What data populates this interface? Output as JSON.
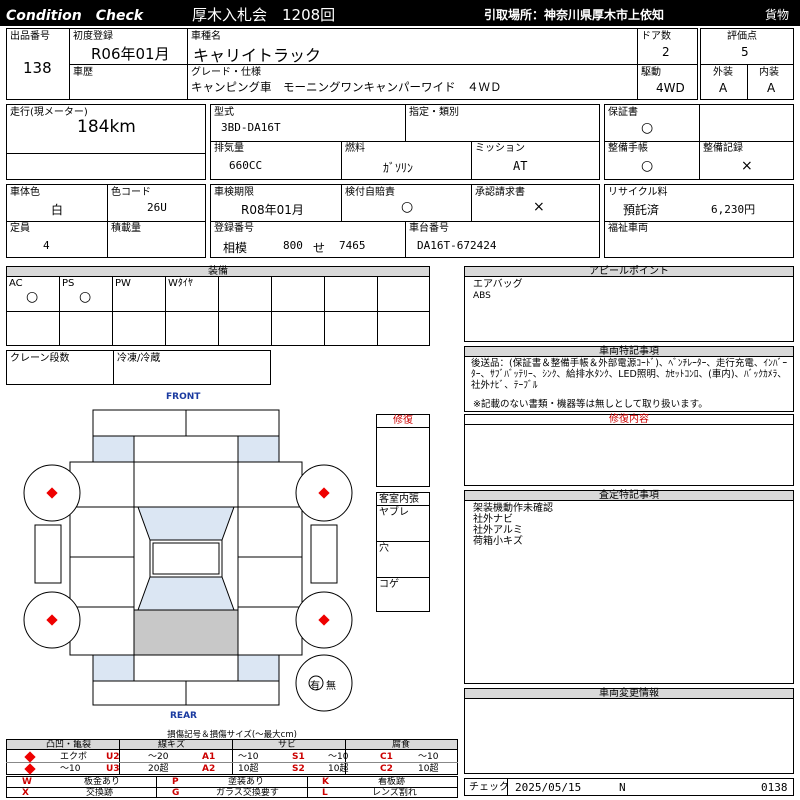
{
  "header": {
    "title": "Condition　Check",
    "auction": "厚木入札会　1208回",
    "pickup": "引取場所：神奈川県厚木市上依知",
    "category": "貨物"
  },
  "vehicle": {
    "lot_label": "出品番号",
    "lot": "138",
    "first_reg_label": "初度登録",
    "first_reg": "R06年01月",
    "name_label": "車種名",
    "name": "キャリイトラック",
    "doors_label": "ドア数",
    "doors": "2",
    "score_label": "評価点",
    "score": "5",
    "history_label": "車歴",
    "grade_label": "グレード・仕様",
    "grade": "キャンピング車　モーニングワンキャンパーワイド　４ＷＤ",
    "drive_label": "駆動",
    "drive": "4WD",
    "exterior_label": "外装",
    "exterior": "A",
    "interior_label": "内装",
    "interior": "A"
  },
  "specs": {
    "mileage_label": "走行(現メーター)",
    "mileage": "184km",
    "model_label": "型式",
    "model": "3BD-DA16T",
    "designation_label": "指定・類別",
    "warranty_label": "保証書",
    "warranty": "○",
    "displacement_label": "排気量",
    "displacement": "660CC",
    "fuel_label": "燃料",
    "fuel": "ｶﾞｿﾘﾝ",
    "transmission_label": "ミッション",
    "transmission": "AT",
    "manual_label": "整備手帳",
    "manual": "○",
    "service_label": "整備記録",
    "service": "×",
    "body_color_label": "車体色",
    "body_color": "白",
    "color_code_label": "色コード",
    "color_code": "26U",
    "inspection_label": "車検期限",
    "inspection": "R08年01月",
    "insurance_label": "検付自賠責",
    "insurance": "○",
    "transfer_label": "承認請求書",
    "transfer": "×",
    "recycle_label": "リサイクル料",
    "recycle_status": "預託済",
    "recycle_amount": "6,230円",
    "capacity_label": "定員",
    "capacity": "4",
    "load_label": "積載量",
    "reg_label": "登録番号",
    "reg_area": "相模",
    "reg_class": "800",
    "reg_kana": "せ",
    "reg_number": "7465",
    "chassis_label": "車台番号",
    "chassis": "DA16T-672424",
    "welfare_label": "福祉車両"
  },
  "equipment": {
    "title": "装備",
    "items": [
      {
        "label": "AC",
        "value": "○"
      },
      {
        "label": "PS",
        "value": "○"
      },
      {
        "label": "PW",
        "value": ""
      },
      {
        "label": "Wﾀｲﾔ",
        "value": ""
      }
    ],
    "crane_label": "クレーン段数",
    "fridge_label": "冷凍/冷蔵"
  },
  "appeal": {
    "title": "アピールポイント",
    "line1": "エアバッグ",
    "line2": "ABS"
  },
  "remarks": {
    "title": "車両特記事項",
    "text": "後送品：(保証書＆整備手帳＆外部電源ｺｰﾄﾞ)、ﾍﾞﾝﾁﾚｰﾀｰ、走行充電、ｲﾝﾊﾞｰﾀｰ、ｻﾌﾞﾊﾞｯﾃﾘｰ、ｼﾝｸ、給排水ﾀﾝｸ、LED照明、ｶｾｯﾄｺﾝﾛ、(車内)、ﾊﾞｯｸｶﾒﾗ、社外ﾅﾋﾞ、ﾃｰﾌﾞﾙ",
    "note": "※記載のない書類・機器等は無しとして取り扱います。"
  },
  "repair": {
    "label": "修復",
    "content_title": "修復内容"
  },
  "inspection_notes": {
    "title": "査定特記事項",
    "lines": [
      "架装機動作未確認",
      "社外ナビ",
      "社外アルミ",
      "荷箱小キズ"
    ]
  },
  "interior_cond": {
    "title": "客室内張",
    "items": [
      "ヤブレ",
      "穴",
      "コゲ"
    ]
  },
  "diagram": {
    "front": "FRONT",
    "rear": "REAR",
    "spare": "有",
    "spare_none": "無"
  },
  "changes": {
    "title": "車両変更情報"
  },
  "legend": {
    "title": "損傷記号＆損傷サイズ(〜最大cm)",
    "group1": "凸凹・亀裂",
    "group2": "線キズ",
    "group3": "サビ",
    "group4": "腐食",
    "r1c1": "エクボ",
    "r1c2": "U2",
    "r1c3": "〜20",
    "r1c4": "A1",
    "r1c5": "〜10",
    "r1c6": "S1",
    "r1c7": "〜10",
    "r1c8": "C1",
    "r1c9": "〜10",
    "r2c1": "〜10",
    "r2c2": "U3",
    "r2c3": "20超",
    "r2c4": "A2",
    "r2c5": "10超",
    "r2c6": "S2",
    "r2c7": "10超",
    "r2c8": "C2",
    "r2c9": "10超",
    "k1": "W",
    "k1t": "板金あり",
    "k2": "P",
    "k2t": "塗装あり",
    "k3": "K",
    "k3t": "看板跡",
    "k4": "X",
    "k4t": "交換跡",
    "k5": "G",
    "k5t": "ガラス交換要す",
    "k6": "L",
    "k6t": "レンズ割れ"
  },
  "footer": {
    "check_label": "チェック",
    "date": "2025/05/15",
    "mark": "N",
    "number": "0138"
  },
  "colors": {
    "header_bg": "#000000",
    "shade": "#d9d9d9",
    "panel_blue": "#dbe6f3",
    "damage_red": "#ee0000",
    "front_blue": "#1a3aa0"
  }
}
